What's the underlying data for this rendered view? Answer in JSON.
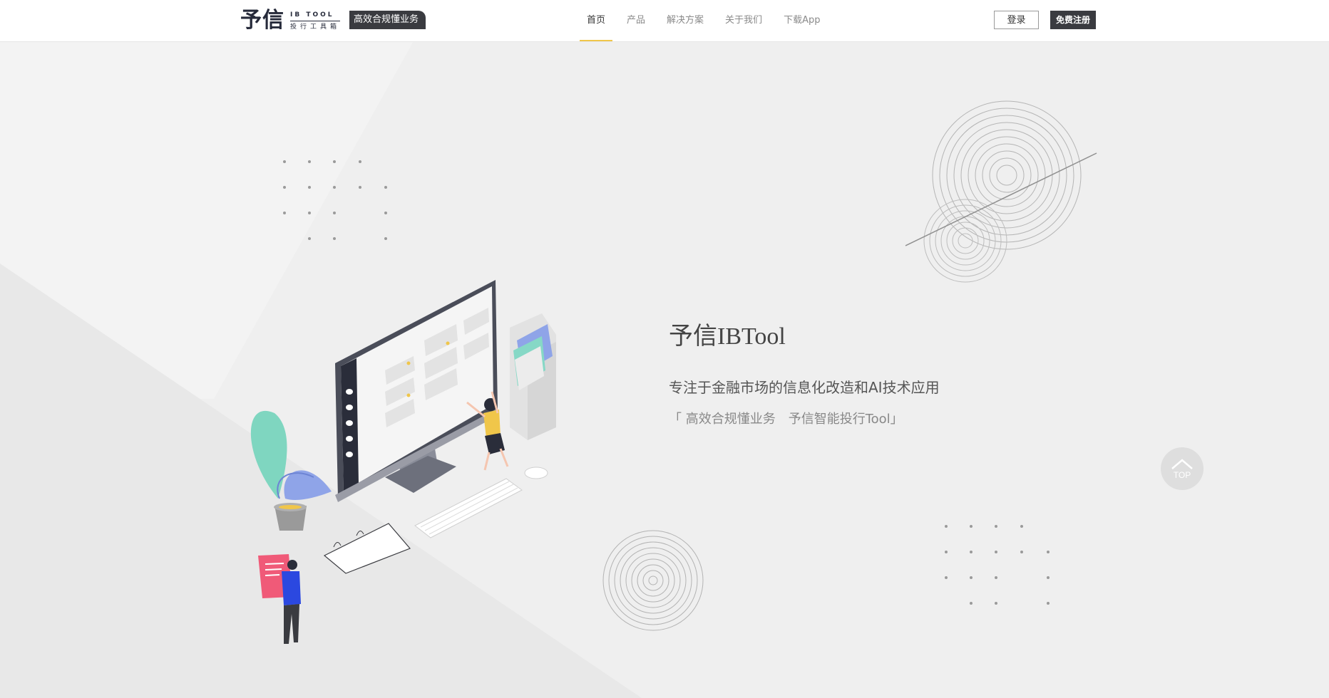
{
  "header": {
    "logo_mark": "予信",
    "logo_en": "IB TOOL",
    "logo_cn": "投行工具箱",
    "badge": "高效合规懂业务",
    "nav": [
      {
        "label": "首页",
        "active": true
      },
      {
        "label": "产品",
        "active": false
      },
      {
        "label": "解决方案",
        "active": false
      },
      {
        "label": "关于我们",
        "active": false
      },
      {
        "label": "下载App",
        "active": false
      }
    ],
    "login_label": "登录",
    "register_label": "免费注册"
  },
  "hero": {
    "title": "予信IBTool",
    "description": "专注于金融市场的信息化改造和AI技术应用",
    "slogan": "「 高效合规懂业务　予信智能投行Tool」"
  },
  "back_to_top": {
    "label": "TOP"
  },
  "colors": {
    "accent": "#f0c64a",
    "dark": "#3a3b40",
    "background": "#efefef"
  }
}
